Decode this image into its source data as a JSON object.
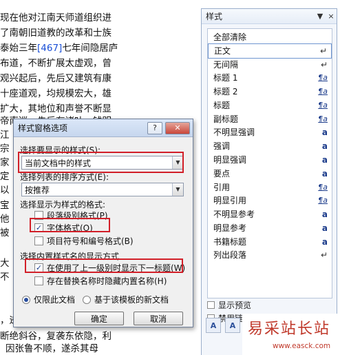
{
  "document": {
    "lines": [
      {
        "pre": "现在他对江南天师道组织进",
        "blue": "",
        "post": ""
      },
      {
        "pre": "了南朝旧道教的改革和士族",
        "blue": "",
        "post": ""
      },
      {
        "pre": "泰始三年",
        "blue": "[467]",
        "post": "七年间隐居庐"
      },
      {
        "pre": "布道，不断扩展太虚观，曾",
        "blue": "",
        "post": ""
      },
      {
        "pre": "观兴起后，先后又建筑有康",
        "blue": "",
        "post": ""
      },
      {
        "pre": "十座道观，均规模宏大，雄",
        "blue": "",
        "post": ""
      },
      {
        "pre": "扩大，其地位和声誉不断显",
        "blue": "",
        "post": ""
      },
      {
        "pre": "帝南巡，先后有诸叶，钱明",
        "blue": "",
        "post": ""
      }
    ],
    "left_fragments": [
      "江",
      "宗",
      "家",
      "定",
      "以",
      "宝",
      "他",
      "被",
      "大",
      "不"
    ],
    "bottom_lines": [
      "，迹",
      "断绝斜谷，复袭东依隐，利",
      "因张鲁不顺，遂杀其母"
    ]
  },
  "styles_pane": {
    "title": "样式",
    "dropdown_icon": "▼",
    "close_icon": "×",
    "items": [
      {
        "label": "全部清除",
        "mark": ""
      },
      {
        "label": "正文",
        "mark": "↵",
        "type": "pilcrow"
      },
      {
        "label": "无间隔",
        "mark": "↵",
        "type": "pilcrow"
      },
      {
        "label": "标题 1",
        "mark": "¶a",
        "type": "para"
      },
      {
        "label": "标题 2",
        "mark": "¶a",
        "type": "para"
      },
      {
        "label": "标题",
        "mark": "¶a",
        "type": "para"
      },
      {
        "label": "副标题",
        "mark": "¶a",
        "type": "para"
      },
      {
        "label": "不明显强调",
        "mark": "a",
        "type": "char"
      },
      {
        "label": "强调",
        "mark": "a",
        "type": "char"
      },
      {
        "label": "明显强调",
        "mark": "a",
        "type": "char"
      },
      {
        "label": "要点",
        "mark": "a",
        "type": "char"
      },
      {
        "label": "引用",
        "mark": "¶a",
        "type": "para"
      },
      {
        "label": "明显引用",
        "mark": "¶a",
        "type": "para"
      },
      {
        "label": "不明显参考",
        "mark": "a",
        "type": "char"
      },
      {
        "label": "明显参考",
        "mark": "a",
        "type": "char"
      },
      {
        "label": "书籍标题",
        "mark": "a",
        "type": "char"
      },
      {
        "label": "列出段落",
        "mark": "↵",
        "type": "pilcrow"
      }
    ],
    "show_preview_label": "显示预览",
    "disable_linked_label": "禁用链接样式",
    "footer_buttons": [
      "A",
      "A"
    ]
  },
  "dialog": {
    "title": "样式窗格选项",
    "help_icon": "?",
    "close_icon": "✕",
    "select_label": "选择要显示的样式(S):",
    "select_value": "当前文档中的样式",
    "sort_label": "选择列表的排序方式(E):",
    "sort_value": "按推荐",
    "format_group_label": "选择显示为样式的格式:",
    "para_level_label": "段落级别格式(P)",
    "para_level_checked": false,
    "font_format_label": "字体格式(O)",
    "font_format_checked": true,
    "bullet_label": "项目符号和编号格式(B)",
    "bullet_checked": false,
    "builtin_group_label": "选择内置样式名的显示方式",
    "show_next_heading_label": "在使用了上一级别时显示下一标题(W)",
    "show_next_heading_checked": true,
    "hide_builtin_label": "存在替换名称时隐藏内置名称(H)",
    "hide_builtin_checked": false,
    "radio_this_doc": "仅限此文档",
    "radio_template": "基于该模板的新文档",
    "ok_label": "确定",
    "cancel_label": "取消"
  },
  "watermark": {
    "title": "易采站长站",
    "url": "www.easck.com"
  },
  "colors": {
    "highlight_red": "#d21f28",
    "watermark_red": "#c0392b",
    "link_blue": "#1a4fd6"
  }
}
